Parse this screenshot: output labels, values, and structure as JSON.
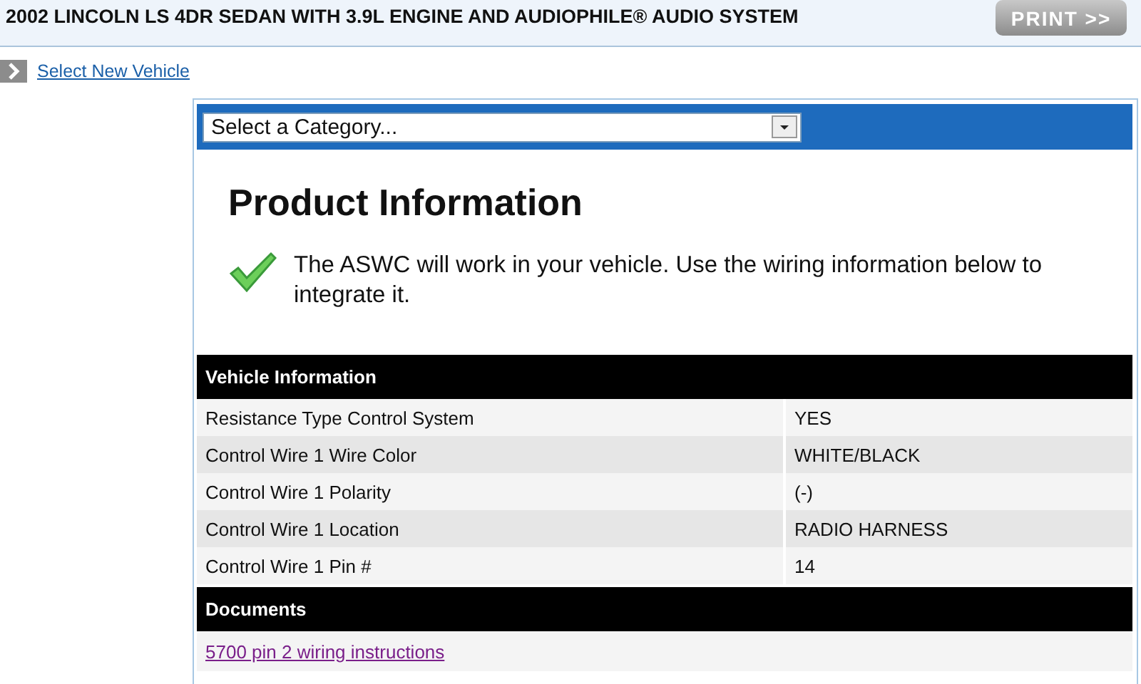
{
  "header": {
    "title": "2002 LINCOLN LS 4DR SEDAN WITH 3.9L ENGINE AND AUDIOPHILE® AUDIO SYSTEM",
    "print_button": "PRINT >>"
  },
  "nav_link": "Select New Vehicle",
  "category_select": {
    "value": "Select a Category..."
  },
  "heading": "Product Information",
  "message": "The ASWC will work in your vehicle. Use the wiring information below to integrate it.",
  "vehicle_info": {
    "title": "Vehicle Information",
    "rows": [
      {
        "label": "Resistance Type Control System",
        "value": "YES"
      },
      {
        "label": "Control Wire 1 Wire Color",
        "value": "WHITE/BLACK"
      },
      {
        "label": "Control Wire 1 Polarity",
        "value": "(-)"
      },
      {
        "label": "Control Wire 1 Location",
        "value": "RADIO HARNESS"
      },
      {
        "label": "Control Wire 1 Pin #",
        "value": "14"
      }
    ]
  },
  "documents": {
    "title": "Documents",
    "links": [
      "5700 pin 2 wiring instructions"
    ]
  }
}
